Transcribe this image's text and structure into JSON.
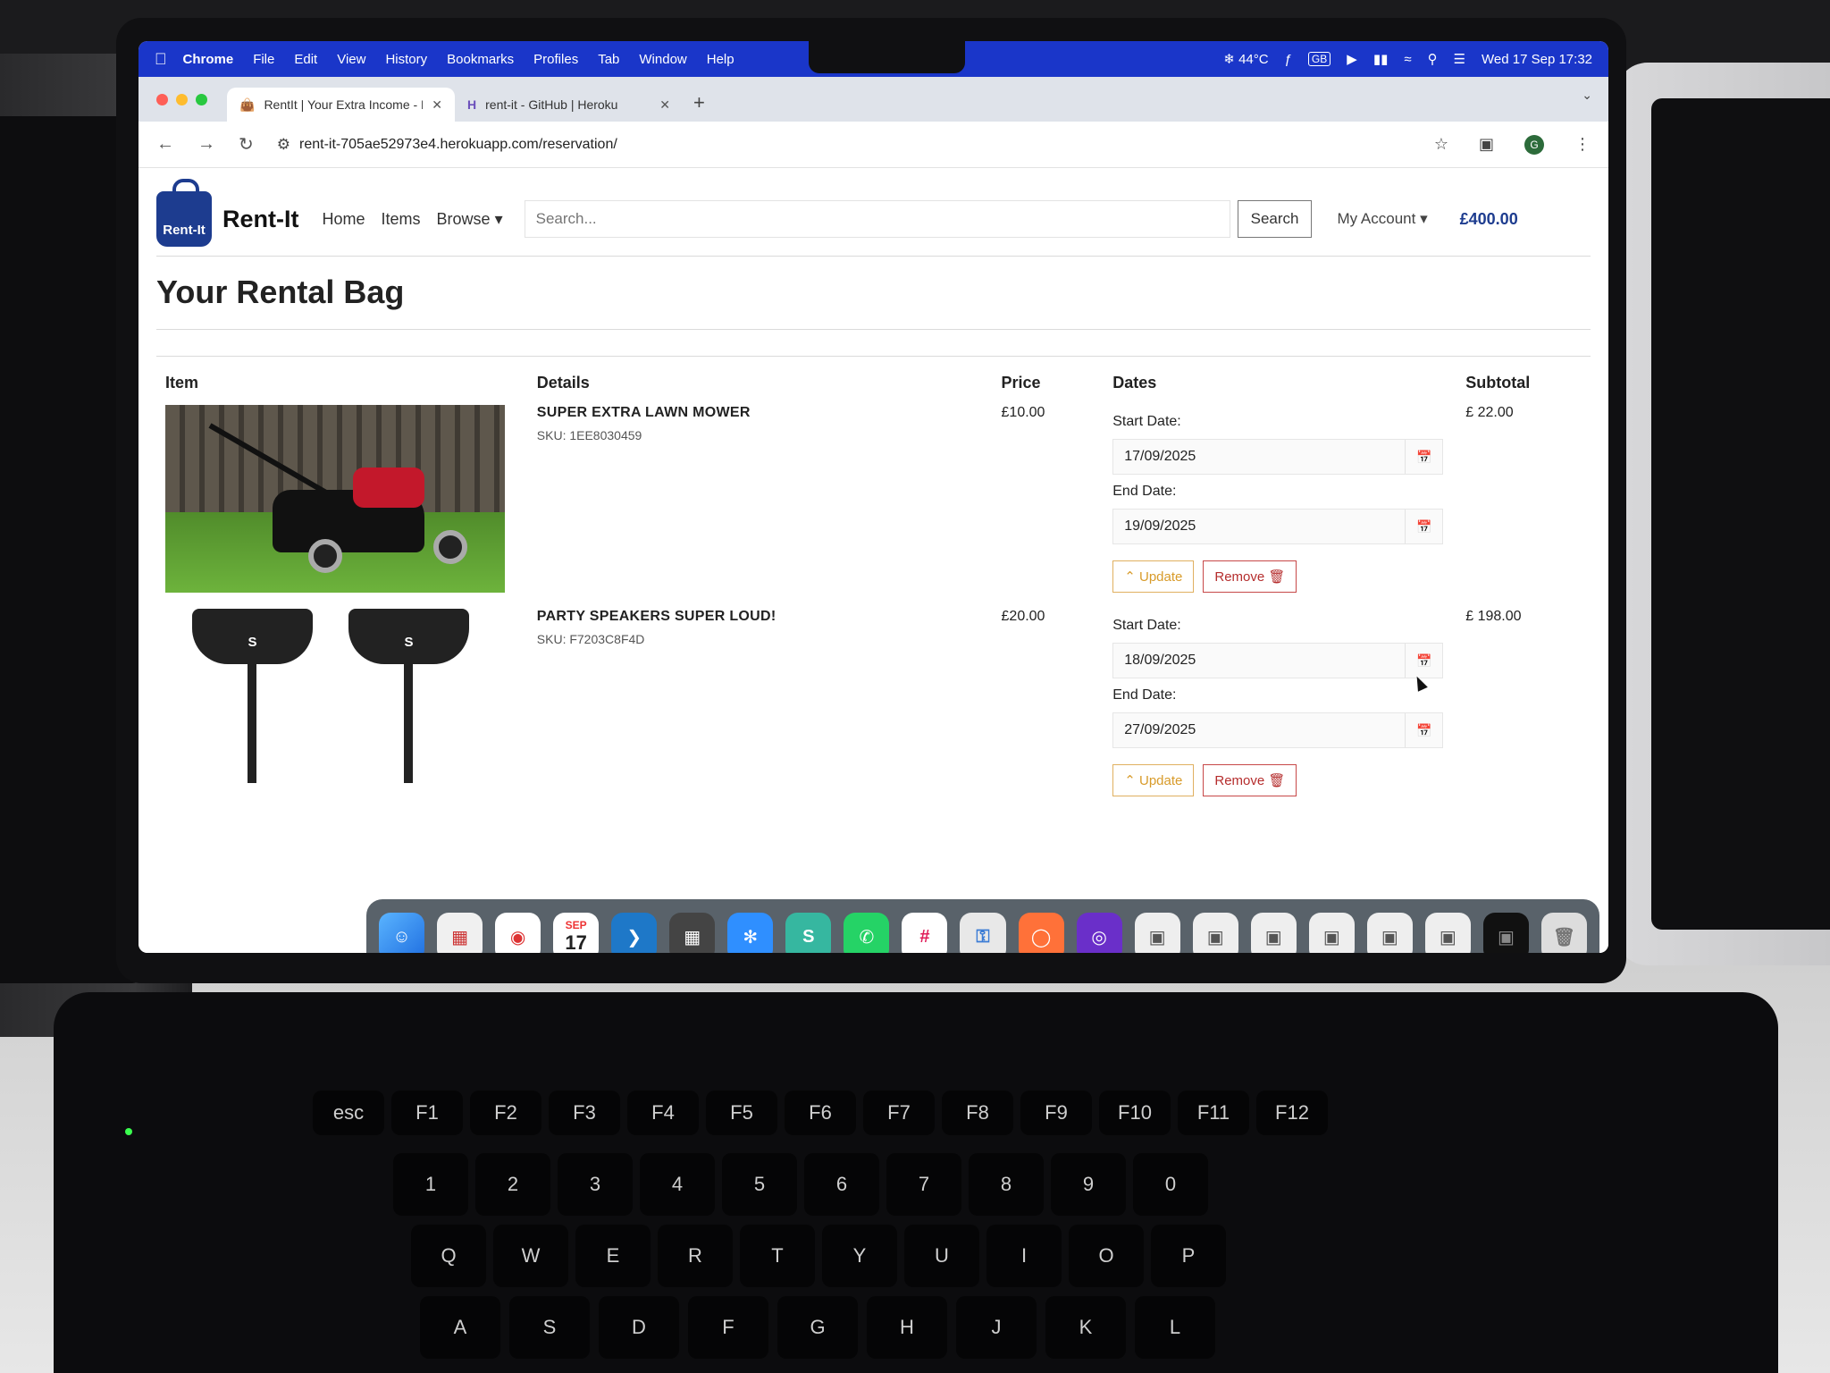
{
  "menubar": {
    "app": "Chrome",
    "items": [
      "File",
      "Edit",
      "View",
      "History",
      "Bookmarks",
      "Profiles",
      "Tab",
      "Window",
      "Help"
    ],
    "temperature": "44°C",
    "keyboard": "GB",
    "datetime": "Wed 17 Sep 17:32"
  },
  "browser": {
    "tabs": [
      {
        "title": "RentIt | Your Extra Income - R"
      },
      {
        "title": "rent-it - GitHub | Heroku"
      }
    ],
    "url": "rent-it-705ae52973e4.herokuapp.com/reservation/",
    "profile_initial": "G"
  },
  "site": {
    "logo_text": "Rent-It",
    "brand": "Rent-It",
    "nav": {
      "home": "Home",
      "items": "Items",
      "browse": "Browse"
    },
    "search": {
      "placeholder": "Search...",
      "button": "Search"
    },
    "account": "My Account",
    "bag_total": "£400.00"
  },
  "page": {
    "title": "Your Rental Bag",
    "columns": {
      "item": "Item",
      "details": "Details",
      "price": "Price",
      "dates": "Dates",
      "subtotal": "Subtotal"
    },
    "start_label": "Start Date:",
    "end_label": "End Date:",
    "update_label": "Update",
    "remove_label": "Remove",
    "items": [
      {
        "name": "SUPER EXTRA LAWN MOWER",
        "sku": "SKU: 1EE8030459",
        "price": "£10.00",
        "start": "17/09/2025",
        "end": "19/09/2025",
        "subtotal": "£ 22.00"
      },
      {
        "name": "PARTY SPEAKERS SUPER LOUD!",
        "sku": "SKU: F7203C8F4D",
        "price": "£20.00",
        "start": "18/09/2025",
        "end": "27/09/2025",
        "subtotal": "£ 198.00"
      }
    ]
  },
  "dock": {
    "calendar_month": "SEP",
    "calendar_day": "17"
  },
  "keyboard": {
    "fn_row": [
      "esc",
      "F1",
      "F2",
      "F3",
      "F4",
      "F5",
      "F6",
      "F7",
      "F8",
      "F9",
      "F10",
      "F11",
      "F12"
    ],
    "num_row": [
      "1",
      "2",
      "3",
      "4",
      "5",
      "6",
      "7",
      "8",
      "9",
      "0"
    ],
    "q_row": [
      "Q",
      "W",
      "E",
      "R",
      "T",
      "Y",
      "U",
      "I",
      "O",
      "P"
    ],
    "a_row": [
      "A",
      "S",
      "D",
      "F",
      "G",
      "H",
      "J",
      "K",
      "L"
    ]
  },
  "colors": {
    "menubar": "#1a36c9",
    "brand": "#1d3c8f",
    "update": "#d89b2a",
    "remove": "#b52d2d"
  }
}
